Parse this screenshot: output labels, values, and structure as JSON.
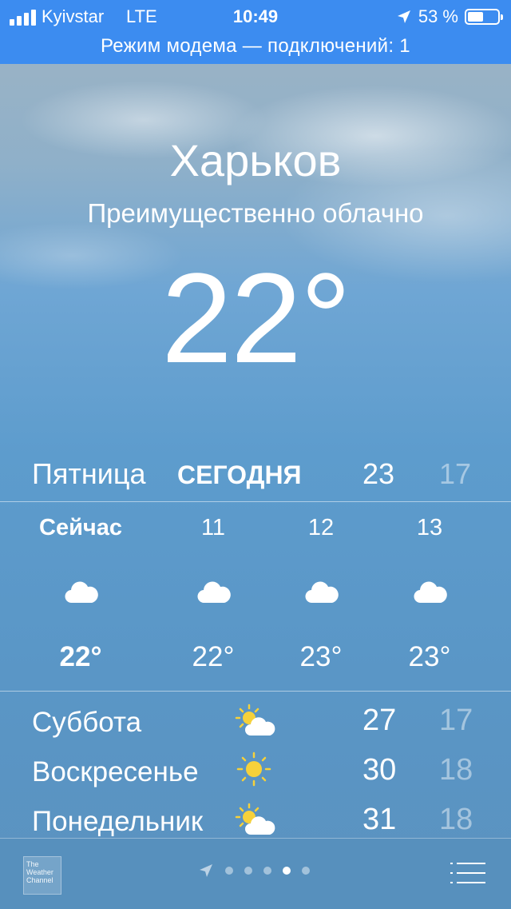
{
  "status_bar": {
    "carrier": "Kyivstar",
    "network": "LTE",
    "time": "10:49",
    "battery_percent": "53 %",
    "battery_level": 0.53,
    "hotspot_text": "Режим модема — подключений: 1",
    "color": "#3c8cf0"
  },
  "weather": {
    "city": "Харьков",
    "condition": "Преимущественно облачно",
    "temperature": "22°"
  },
  "today": {
    "day": "Пятница",
    "label": "СЕГОДНЯ",
    "high": "23",
    "low": "17"
  },
  "hourly": [
    {
      "time": "Сейчас",
      "icon": "cloud-icon",
      "temp": "22°"
    },
    {
      "time": "11",
      "icon": "cloud-icon",
      "temp": "22°"
    },
    {
      "time": "12",
      "icon": "cloud-icon",
      "temp": "23°"
    },
    {
      "time": "13",
      "icon": "cloud-icon",
      "temp": "23°"
    }
  ],
  "daily": [
    {
      "day": "Суббота",
      "icon": "partly-sunny-icon",
      "high": "27",
      "low": "17"
    },
    {
      "day": "Воскресенье",
      "icon": "sun-icon",
      "high": "30",
      "low": "18"
    },
    {
      "day": "Понедельник",
      "icon": "partly-sunny-icon",
      "high": "31",
      "low": "18"
    }
  ],
  "footer": {
    "logo_text": "The Weather Channel",
    "page_count": 5,
    "active_page": 4
  }
}
